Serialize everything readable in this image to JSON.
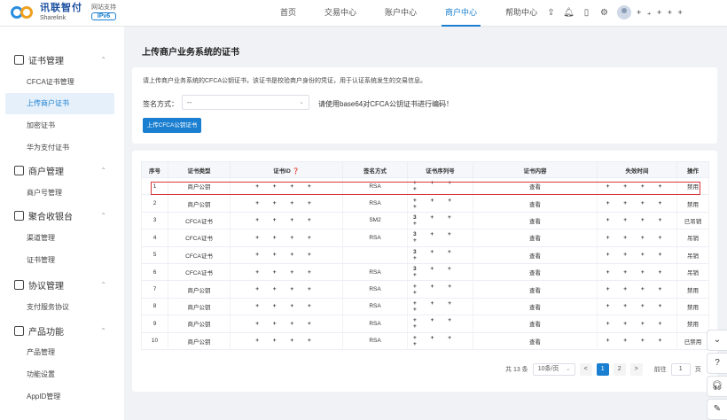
{
  "brand": {
    "name_cn": "讯联智付",
    "name_en": "Sharelink",
    "network_label": "网站支持",
    "ipv6_badge": "IPv6"
  },
  "nav": {
    "items": [
      {
        "label": "首页",
        "active": false
      },
      {
        "label": "交易中心",
        "active": false
      },
      {
        "label": "账户中心",
        "active": false
      },
      {
        "label": "商户中心",
        "active": true
      },
      {
        "label": "帮助中心",
        "active": false
      }
    ],
    "icons": [
      "upload-icon",
      "bell-icon",
      "document-icon",
      "settings-icon"
    ],
    "user_name": "+ ₊ + + +"
  },
  "sidebar": {
    "groups": [
      {
        "label": "证书管理",
        "icon": "certificate-icon",
        "items": [
          {
            "label": "CFCA证书管理",
            "active": false
          },
          {
            "label": "上传商户证书",
            "active": true
          },
          {
            "label": "加密证书",
            "active": false
          },
          {
            "label": "华为支付证书",
            "active": false
          }
        ]
      },
      {
        "label": "商户管理",
        "icon": "store-icon",
        "items": [
          {
            "label": "商户号管理",
            "active": false
          }
        ]
      },
      {
        "label": "聚合收银台",
        "icon": "cashier-icon",
        "items": [
          {
            "label": "渠道管理",
            "active": false
          },
          {
            "label": "证书管理",
            "active": false
          }
        ]
      },
      {
        "label": "协议管理",
        "icon": "contract-icon",
        "items": [
          {
            "label": "支付服务协议",
            "active": false
          }
        ]
      },
      {
        "label": "产品功能",
        "icon": "product-icon",
        "items": [
          {
            "label": "产品管理",
            "active": false
          },
          {
            "label": "功能设置",
            "active": false
          },
          {
            "label": "AppID管理",
            "active": false
          }
        ]
      }
    ]
  },
  "page": {
    "title": "上传商户业务系统的证书",
    "notice": "请上传商户业务系统的CFCA公钥证书，该证书是校验商户身份的凭证，用于认证系统发生的交易信息。",
    "sign_label": "签名方式：",
    "sign_value": "--",
    "sign_hint": "请使用base64对CFCA公钥证书进行编码！",
    "upload_button": "上传CFCA公钥证书"
  },
  "table": {
    "headers": [
      "序号",
      "证书类型",
      "证书ID ❓",
      "签名方式",
      "证书序列号",
      "证书内容",
      "失效时间",
      "操作"
    ],
    "rows": [
      {
        "no": "1",
        "type": "商户公钥",
        "id": "+ + + +",
        "sign": "RSA",
        "serial": "+ + + +",
        "content": "查看",
        "expire": "+ + + +",
        "action": "禁用",
        "action_type": "link"
      },
      {
        "no": "2",
        "type": "商户公钥",
        "id": "+ + + +",
        "sign": "RSA",
        "serial": "+ + + +",
        "content": "查看",
        "expire": "+ + + +",
        "action": "禁用",
        "action_type": "link"
      },
      {
        "no": "3",
        "type": "CFCA证书",
        "id": "+ + + +",
        "sign": "SM2",
        "serial": "3 + + +",
        "content": "查看",
        "expire": "+ + + +",
        "action": "已吊销",
        "action_type": "danger"
      },
      {
        "no": "4",
        "type": "CFCA证书",
        "id": "+ + + +",
        "sign": "RSA",
        "serial": "3 + + +",
        "content": "查看",
        "expire": "+ + + +",
        "action": "吊销",
        "action_type": "link"
      },
      {
        "no": "5",
        "type": "CFCA证书",
        "id": "+ + + +",
        "sign": "",
        "serial": "3 + + +",
        "content": "查看",
        "expire": "+ + + +",
        "action": "吊销",
        "action_type": "link"
      },
      {
        "no": "6",
        "type": "CFCA证书",
        "id": "+ + + +",
        "sign": "RSA",
        "serial": "3 + + +",
        "content": "查看",
        "expire": "+ + + +",
        "action": "吊销",
        "action_type": "link"
      },
      {
        "no": "7",
        "type": "商户公钥",
        "id": "+ + + +",
        "sign": "RSA",
        "serial": "+ + + +",
        "content": "查看",
        "expire": "+ + + +",
        "action": "禁用",
        "action_type": "link"
      },
      {
        "no": "8",
        "type": "商户公钥",
        "id": "+ + + +",
        "sign": "RSA",
        "serial": "+ + + +",
        "content": "查看",
        "expire": "+ + + +",
        "action": "禁用",
        "action_type": "link"
      },
      {
        "no": "9",
        "type": "商户公钥",
        "id": "+ + + +",
        "sign": "RSA",
        "serial": "+ + + +",
        "content": "查看",
        "expire": "+ + + +",
        "action": "禁用",
        "action_type": "link"
      },
      {
        "no": "10",
        "type": "商户公钥",
        "id": "+ + + +",
        "sign": "RSA",
        "serial": "+ + + +",
        "content": "查看",
        "expire": "+ + + +",
        "action": "已禁用",
        "action_type": "danger"
      }
    ]
  },
  "pagination": {
    "total_text": "共 13 条",
    "page_size": "10条/页",
    "prev": "<",
    "pages": [
      "1",
      "2"
    ],
    "current": "1",
    "next": ">",
    "goto_label": "前往",
    "goto_value": "1",
    "page_suffix": "页"
  },
  "float_buttons": [
    "chevron-down-icon",
    "help-icon",
    "headset-icon",
    "feedback-icon"
  ],
  "colors": {
    "accent": "#1a7fd0",
    "danger": "#e94040",
    "highlight_border": "#d9363e"
  }
}
